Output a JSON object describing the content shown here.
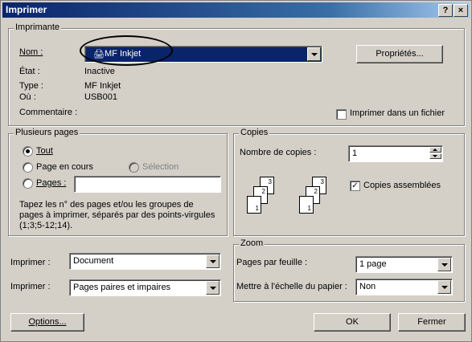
{
  "window": {
    "title": "Imprimer",
    "help_btn": "?",
    "close_btn": "×"
  },
  "printer": {
    "legend": "Imprimante",
    "name_label": "Nom :",
    "name_value": "MF Inkjet",
    "properties_button": "Propriétés...",
    "status_label": "État :",
    "status_value": "Inactive",
    "type_label": "Type :",
    "type_value": "MF Inkjet",
    "where_label": "Où :",
    "where_value": "USB001",
    "comment_label": "Commentaire :",
    "print_to_file": "Imprimer dans un fichier"
  },
  "range": {
    "legend": "Plusieurs pages",
    "all": "Tout",
    "current": "Page en cours",
    "selection": "Sélection",
    "pages": "Pages :",
    "hint": "Tapez les n° des pages et/ou les groupes de pages à imprimer, séparés par des points-virgules (1;3;5-12;14)."
  },
  "copies": {
    "legend": "Copies",
    "count_label": "Nombre de copies :",
    "count_value": "1",
    "collate": "Copies assemblées",
    "page_nums": [
      "3",
      "2",
      "1"
    ]
  },
  "print_what": {
    "label": "Imprimer :",
    "value": "Document"
  },
  "print_which": {
    "label": "Imprimer :",
    "value": "Pages paires et impaires"
  },
  "zoom": {
    "legend": "Zoom",
    "pps_label": "Pages par feuille :",
    "pps_value": "1 page",
    "scale_label": "Mettre à l'échelle du papier :",
    "scale_value": "Non"
  },
  "buttons": {
    "options": "Options...",
    "ok": "OK",
    "close": "Fermer"
  }
}
